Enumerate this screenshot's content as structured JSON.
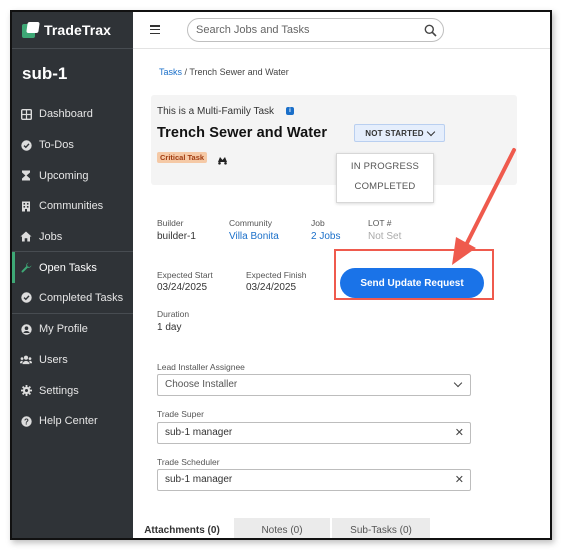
{
  "app": {
    "brand_name": "TradeTrax",
    "account_name": "sub-1",
    "accent_color": "#3ea876"
  },
  "sidebar": {
    "items": [
      {
        "label": "Dashboard",
        "icon": "dashboard-icon"
      },
      {
        "label": "To-Dos",
        "icon": "check-circle-icon"
      },
      {
        "label": "Upcoming",
        "icon": "hourglass-icon"
      },
      {
        "label": "Communities",
        "icon": "building-icon"
      },
      {
        "label": "Jobs",
        "icon": "home-icon"
      },
      {
        "label": "Open Tasks",
        "icon": "wrench-icon",
        "active": true
      },
      {
        "label": "Completed Tasks",
        "icon": "check-circle-icon"
      },
      {
        "label": "My Profile",
        "icon": "user-icon"
      },
      {
        "label": "Users",
        "icon": "users-icon"
      },
      {
        "label": "Settings",
        "icon": "gear-icon"
      },
      {
        "label": "Help Center",
        "icon": "help-icon"
      }
    ]
  },
  "topbar": {
    "search_placeholder": "Search Jobs and Tasks"
  },
  "breadcrumb": {
    "parent": "Tasks",
    "separator": "/",
    "current": "Trench Sewer and Water"
  },
  "task": {
    "type_text": "This is a Multi-Family Task",
    "info_mark": "i",
    "title": "Trench Sewer and Water",
    "status_label": "NOT STARTED",
    "status_options": [
      "IN PROGRESS",
      "COMPLETED"
    ],
    "critical_badge": "Critical Task",
    "details": {
      "builder_label": "Builder",
      "builder_value": "builder-1",
      "community_label": "Community",
      "community_value": "Villa Bonita",
      "job_label": "Job",
      "job_value": "2 Jobs",
      "lot_label": "LOT #",
      "lot_value": "Not Set",
      "expected_start_label": "Expected Start",
      "expected_start_value": "03/24/2025",
      "expected_finish_label": "Expected Finish",
      "expected_finish_value": "03/24/2025",
      "duration_label": "Duration",
      "duration_value": "1 day"
    },
    "send_update_label": "Send Update Request",
    "assignees": {
      "lead_installer_label": "Lead Installer Assignee",
      "lead_installer_value": "Choose Installer",
      "trade_super_label": "Trade Super",
      "trade_super_value": "sub-1 manager",
      "trade_scheduler_label": "Trade Scheduler",
      "trade_scheduler_value": "sub-1 manager"
    },
    "tabs": [
      "Attachments (0)",
      "Notes (0)",
      "Sub-Tasks (0)"
    ]
  },
  "annotation": {
    "color": "#ef5a4d"
  }
}
